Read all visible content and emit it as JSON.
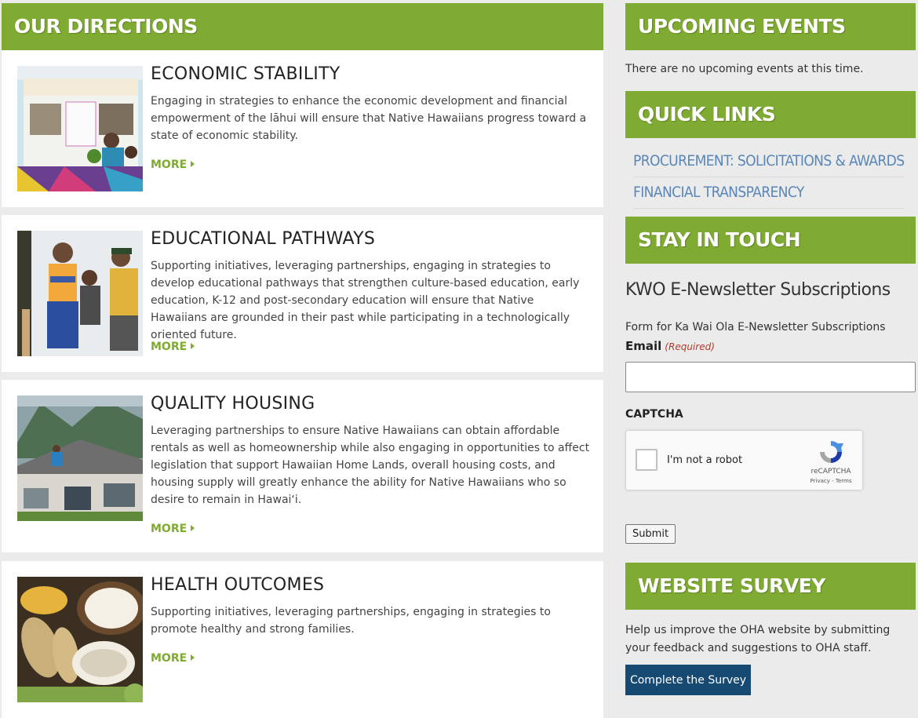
{
  "colors": {
    "accent_green": "#7fab32",
    "link_blue": "#5a86b8",
    "button_navy": "#174a73"
  },
  "directions": {
    "title": "OUR DIRECTIONS",
    "items": [
      {
        "title": "ECONOMIC STABILITY",
        "text": "Engaging in strategies to enhance the economic development and financial empowerment of the lāhui will ensure that Native Hawaiians progress toward a state of economic stability.",
        "more": "MORE"
      },
      {
        "title": "EDUCATIONAL PATHWAYS",
        "text": "Supporting initiatives, leveraging partnerships, engaging in strategies to develop educational pathways that strengthen culture-based education, early education, K-12 and post-secondary education will ensure that Native Hawaiians are grounded in their past while participating in a technologically oriented future.",
        "more": "MORE"
      },
      {
        "title": "QUALITY HOUSING",
        "text": "Leveraging partnerships to ensure Native Hawaiians can obtain affordable rentals as well as homeownership while also engaging in opportunities to affect legislation that support Hawaiian Home Lands, overall housing costs, and housing supply will greatly enhance the ability for Native Hawaiians who so desire to remain in Hawaiʻi.",
        "more": "MORE"
      },
      {
        "title": "HEALTH OUTCOMES",
        "text": "Supporting initiatives, leveraging partnerships, engaging in strategies to promote healthy and strong families.",
        "more": "MORE"
      }
    ]
  },
  "events": {
    "title": "UPCOMING EVENTS",
    "empty_text": "There are no upcoming events at this time."
  },
  "quick_links": {
    "title": "QUICK LINKS",
    "items": [
      "PROCUREMENT: SOLICITATIONS & AWARDS",
      "FINANCIAL TRANSPARENCY"
    ]
  },
  "stay_in_touch": {
    "title": "STAY IN TOUCH",
    "newsletter_title": "KWO E-Newsletter Subscriptions",
    "form_description": "Form for Ka Wai Ola E-Newsletter Subscriptions",
    "email_label": "Email",
    "required_text": "(Required)",
    "email_value": "",
    "captcha_label": "CAPTCHA",
    "recaptcha_text": "I'm not a robot",
    "recaptcha_brand": "reCAPTCHA",
    "recaptcha_terms": "Privacy - Terms",
    "submit_label": "Submit"
  },
  "survey": {
    "title": "WEBSITE SURVEY",
    "text": "Help us improve the OHA website by submitting your feedback and suggestions to OHA staff.",
    "button_label": "Complete the Survey"
  },
  "icons": [
    "chevron-right-icon",
    "recaptcha-logo-icon",
    "checkbox-icon"
  ]
}
